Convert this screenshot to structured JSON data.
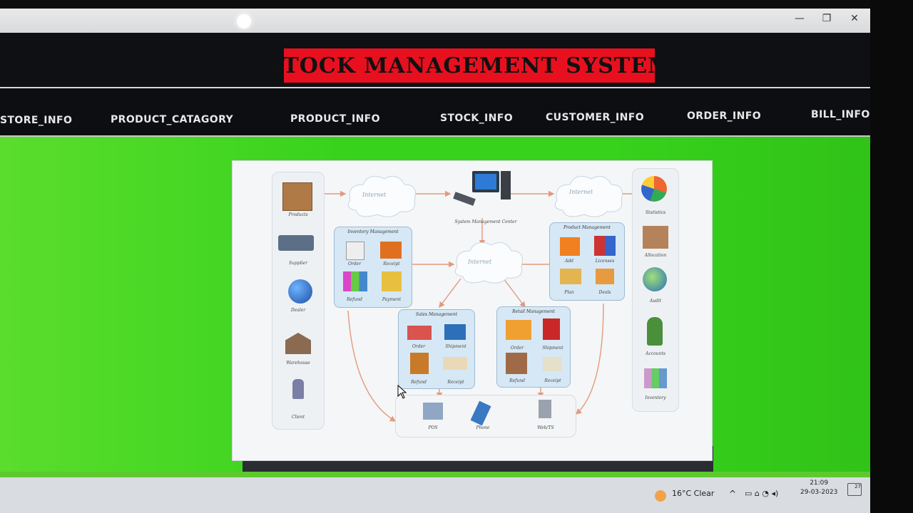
{
  "window": {
    "minimize_glyph": "—",
    "maximize_glyph": "❐",
    "close_glyph": "✕"
  },
  "header": {
    "title": "STOCK MANAGEMENT SYSTEM"
  },
  "nav": {
    "items": [
      {
        "label": "STORE_INFO"
      },
      {
        "label": "PRODUCT_CATAGORY"
      },
      {
        "label": "PRODUCT_INFO"
      },
      {
        "label": "STOCK_INFO"
      },
      {
        "label": "CUSTOMER_INFO"
      },
      {
        "label": "ORDER_INFO"
      },
      {
        "label": "BILL_INFO"
      }
    ]
  },
  "diagram": {
    "center_label": "System Management Center",
    "cloud_label": "Internet",
    "left_column": [
      "Products",
      "Supplier",
      "Dealer",
      "Warehouse",
      "Client"
    ],
    "right_column": [
      "Statistics",
      "Allocation",
      "Audit",
      "Accounts",
      "Inventory"
    ],
    "inventory_group": {
      "title": "Inventory Management",
      "items": [
        "Order",
        "Receipt",
        "Refund",
        "Payment"
      ]
    },
    "product_group": {
      "title": "Product Management",
      "items": [
        "Add",
        "Licenses",
        "Plan",
        "Deals"
      ]
    },
    "sales_group": {
      "title": "Sales Management",
      "items": [
        "Order",
        "Shipment",
        "Refund",
        "Receipt"
      ]
    },
    "retail_group": {
      "title": "Retail Management",
      "items": [
        "Order",
        "Shipment",
        "Refund",
        "Receipt"
      ]
    },
    "bottom_group": [
      "POS",
      "Phone",
      "Web/TS"
    ]
  },
  "taskbar": {
    "weather": "16°C  Clear",
    "time": "21:09",
    "date": "29-03-2023",
    "notification_count": "27"
  },
  "colors": {
    "title_bg": "#e8101f",
    "header_bg": "#0e1014",
    "content_bg": "#37d21c",
    "group_bg": "#d6e8f5"
  }
}
